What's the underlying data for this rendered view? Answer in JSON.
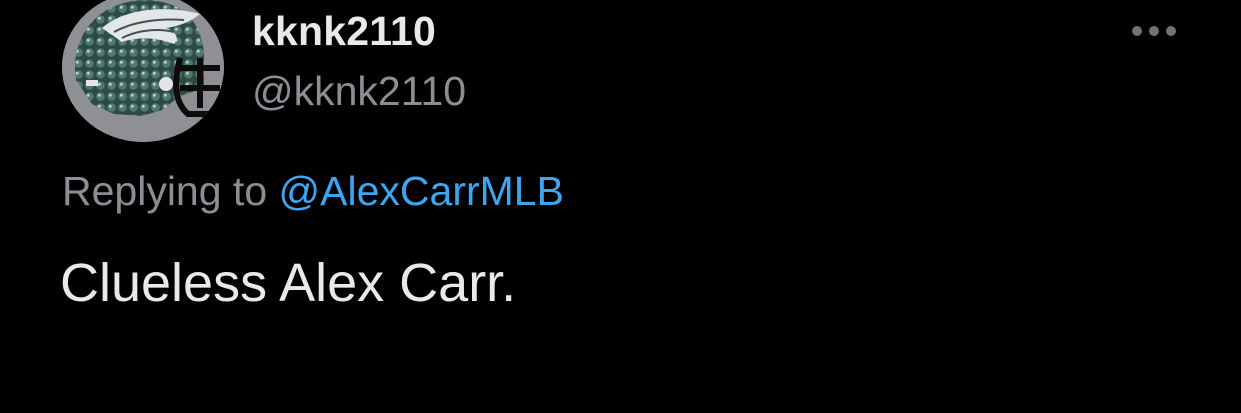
{
  "tweet": {
    "author": {
      "display_name": "kknk2110",
      "handle": "@kknk2110",
      "avatar_icon": "eagles-helmet-avatar-icon"
    },
    "more_icon": "more-dots-icon",
    "reply": {
      "prefix": "Replying to",
      "mention": "@AlexCarrMLB"
    },
    "text": "Clueless Alex Carr."
  },
  "colors": {
    "background": "#000000",
    "primary_text": "#e7e9ea",
    "secondary_text": "#8b8f94",
    "link": "#3ea6f0",
    "avatar_bg": "#8e9094"
  }
}
